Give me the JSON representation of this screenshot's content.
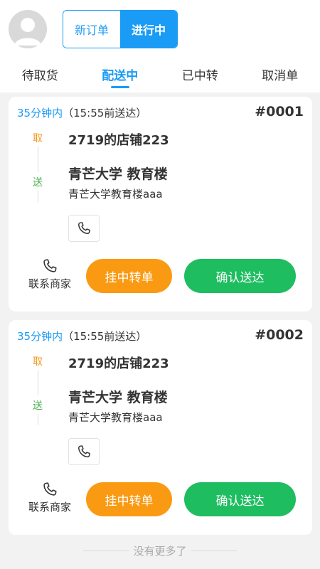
{
  "header": {
    "segment": {
      "left_label": "新订单",
      "right_label": "进行中"
    }
  },
  "tabs": [
    {
      "label": "待取货"
    },
    {
      "label": "配送中"
    },
    {
      "label": "已中转"
    },
    {
      "label": "取消单"
    }
  ],
  "orders": [
    {
      "eta": "35分钟内",
      "deadline": "（15:55前送达）",
      "number": "#0001",
      "pickup_tag": "取",
      "dropoff_tag": "送",
      "shop": "2719的店铺223",
      "destination": "青芒大学 教育楼",
      "address": "青芒大学教育楼aaa",
      "contact_label": "联系商家",
      "transfer_label": "挂中转单",
      "confirm_label": "确认送达"
    },
    {
      "eta": "35分钟内",
      "deadline": "（15:55前送达）",
      "number": "#0002",
      "pickup_tag": "取",
      "dropoff_tag": "送",
      "shop": "2719的店铺223",
      "destination": "青芒大学 教育楼",
      "address": "青芒大学教育楼aaa",
      "contact_label": "联系商家",
      "transfer_label": "挂中转单",
      "confirm_label": "确认送达"
    }
  ],
  "footer": {
    "text": "没有更多了"
  },
  "colors": {
    "accent": "#1a9bf5",
    "orange": "#fa9a12",
    "green": "#1ebd60"
  },
  "icons": {
    "avatar": "user-avatar-icon",
    "phone": "phone-icon"
  }
}
